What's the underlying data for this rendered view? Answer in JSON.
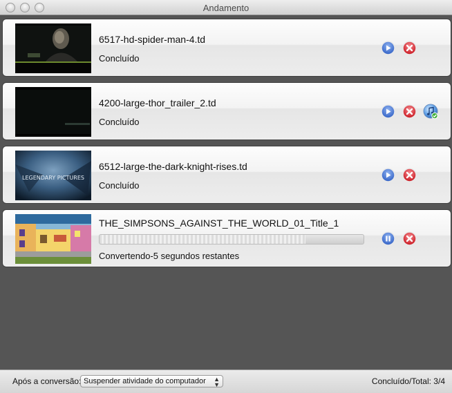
{
  "window": {
    "title": "Andamento"
  },
  "items": [
    {
      "filename": "6517-hd-spider-man-4.td",
      "status": "Concluído",
      "thumbnail": "dark-movie-scene-thumbnail",
      "state": "done",
      "itunes": false
    },
    {
      "filename": "4200-large-thor_trailer_2.td",
      "status": "Concluído",
      "thumbnail": "dark-title-card-thumbnail",
      "state": "done",
      "itunes": true
    },
    {
      "filename": "6512-large-the-dark-knight-rises.td",
      "status": "Concluído",
      "thumbnail": "legendary-pictures-logo-thumbnail",
      "thumbnail_text": "LEGENDARY PICTURES",
      "state": "done",
      "itunes": false
    },
    {
      "filename": "THE_SIMPSONS_AGAINST_THE_WORLD_01_Title_1",
      "status": "Convertendo-5 segundos restantes",
      "thumbnail": "cartoon-street-scene-thumbnail",
      "state": "converting",
      "progress": 0.78,
      "itunes": false
    }
  ],
  "footer": {
    "after_label": "Após a conversão:",
    "after_option": "Suspender atividade do computador",
    "total": "Concluído/Total: 3/4"
  },
  "colors": {
    "play": "#3f6fd1",
    "delete": "#d9232c",
    "background": "#555555"
  },
  "icons": {
    "play": "play-icon",
    "pause": "pause-icon",
    "delete": "delete-icon",
    "itunes": "itunes-icon"
  }
}
